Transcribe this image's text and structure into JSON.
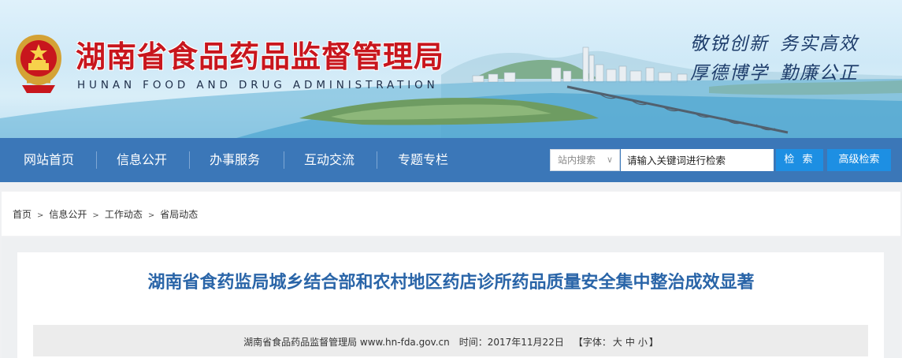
{
  "header": {
    "title": "湖南省食品药品监督管理局",
    "subtitle": "HUNAN FOOD AND DRUG ADMINISTRATION",
    "motto_line1": [
      "敬锐创新",
      "务实高效"
    ],
    "motto_line2": [
      "厚德博学",
      "勤廉公正"
    ],
    "emblem_icon": "national-emblem-icon"
  },
  "nav": {
    "items": [
      "网站首页",
      "信息公开",
      "办事服务",
      "互动交流",
      "专题专栏"
    ]
  },
  "search": {
    "scope_label": "站内搜索",
    "scope_caret": "∨",
    "placeholder": "请输入关键词进行检索",
    "search_button": "检 索",
    "advanced_button": "高级检索"
  },
  "breadcrumb": {
    "items": [
      "首页",
      "信息公开",
      "工作动态",
      "省局动态"
    ],
    "separator": ">"
  },
  "article": {
    "title": "湖南省食药监局城乡结合部和农村地区药店诊所药品质量安全集中整治成效显著",
    "source": "湖南省食品药品监督管理局 www.hn-fda.gov.cn",
    "time": "时间：2017年11月22日",
    "font_label_open": "【字体：",
    "font_large": "大",
    "font_medium": "中",
    "font_small": "小",
    "font_label_close": "】"
  },
  "colors": {
    "title_red": "#c8161d",
    "nav_blue": "#3b77b8",
    "button_blue": "#1d8fe3",
    "article_title_blue": "#2a65a8"
  }
}
